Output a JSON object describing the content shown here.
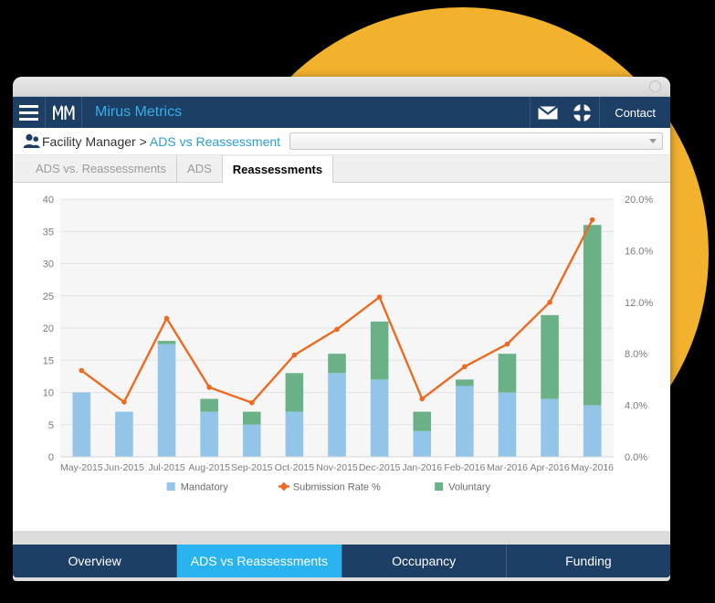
{
  "window": {
    "titlebar_dot": "window-control"
  },
  "appbar": {
    "menu_icon": "hamburger-menu-icon",
    "logo_glyph": "ℳℳ",
    "logo_name": "mirus-logo",
    "title": "Mirus Metrics",
    "mail_icon": "envelope-icon",
    "help_icon": "life-ring-icon",
    "contact_label": "Contact",
    "bg_color": "#1d3f66",
    "title_color": "#33b0e8"
  },
  "breadcrumb": {
    "user_icon": "user-icon",
    "root": "Facility Manager ",
    "separator": "> ",
    "current": "ADS vs Reassessment",
    "select_value": "",
    "select_placeholder": ""
  },
  "tabs": [
    {
      "label": "ADS vs. Reassessments",
      "active": false
    },
    {
      "label": "ADS",
      "active": false
    },
    {
      "label": "Reassessments",
      "active": true
    }
  ],
  "bottom_nav": [
    {
      "label": "Overview",
      "active": false
    },
    {
      "label": "ADS vs Reassessments",
      "active": true
    },
    {
      "label": "Occupancy",
      "active": false
    },
    {
      "label": "Funding",
      "active": false
    }
  ],
  "chart_data": {
    "type": "bar",
    "title": "",
    "xlabel": "",
    "ylabel": "",
    "stacked": true,
    "grid": true,
    "legend_position": "bottom",
    "categories": [
      "May-2015",
      "Jun-2015",
      "Jul-2015",
      "Aug-2015",
      "Sep-2015",
      "Oct-2015",
      "Nov-2015",
      "Dec-2015",
      "Jan-2016",
      "Feb-2016",
      "Mar-2016",
      "Apr-2016",
      "May-2016"
    ],
    "ylim": [
      0,
      40
    ],
    "yticks": [
      0,
      5,
      10,
      15,
      20,
      25,
      30,
      35,
      40
    ],
    "ytick_labels": [
      "0",
      "5",
      "10",
      "15",
      "20",
      "25",
      "30",
      "35",
      "40"
    ],
    "y2lim": [
      0,
      20
    ],
    "y2ticks": [
      0,
      4,
      8,
      12,
      16,
      20
    ],
    "y2tick_labels": [
      "0.0%",
      "4.0%",
      "8.0%",
      "12.0%",
      "16.0%",
      "20.0%"
    ],
    "series": [
      {
        "name": "Mandatory",
        "type": "bar",
        "color": "#92c5e8",
        "axis": "left",
        "values": [
          10,
          7,
          17.5,
          7,
          5,
          7,
          13,
          12,
          4,
          11,
          10,
          9,
          8
        ]
      },
      {
        "name": "Voluntary",
        "type": "bar",
        "color": "#6ab187",
        "axis": "left",
        "values": [
          0,
          0,
          0.5,
          2,
          2,
          6,
          3,
          9,
          3,
          1,
          6,
          13,
          28
        ]
      },
      {
        "name": "Submission Rate %",
        "type": "line",
        "color": "#ec6a21",
        "axis": "right",
        "marker": "diamond",
        "values": [
          6.7,
          4.25,
          10.75,
          5.4,
          4.2,
          7.9,
          9.9,
          12.4,
          4.5,
          7.0,
          8.75,
          12.0,
          18.4
        ]
      }
    ],
    "legend": [
      {
        "label": "Mandatory",
        "color": "#92c5e8",
        "marker": "square"
      },
      {
        "label": "Submission Rate %",
        "color": "#ec6a21",
        "marker": "line-diamond"
      },
      {
        "label": "Voluntary",
        "color": "#6ab187",
        "marker": "square"
      }
    ],
    "axis_text_color": "#7b7b7b",
    "plot_bg": "#f6f6f6"
  }
}
